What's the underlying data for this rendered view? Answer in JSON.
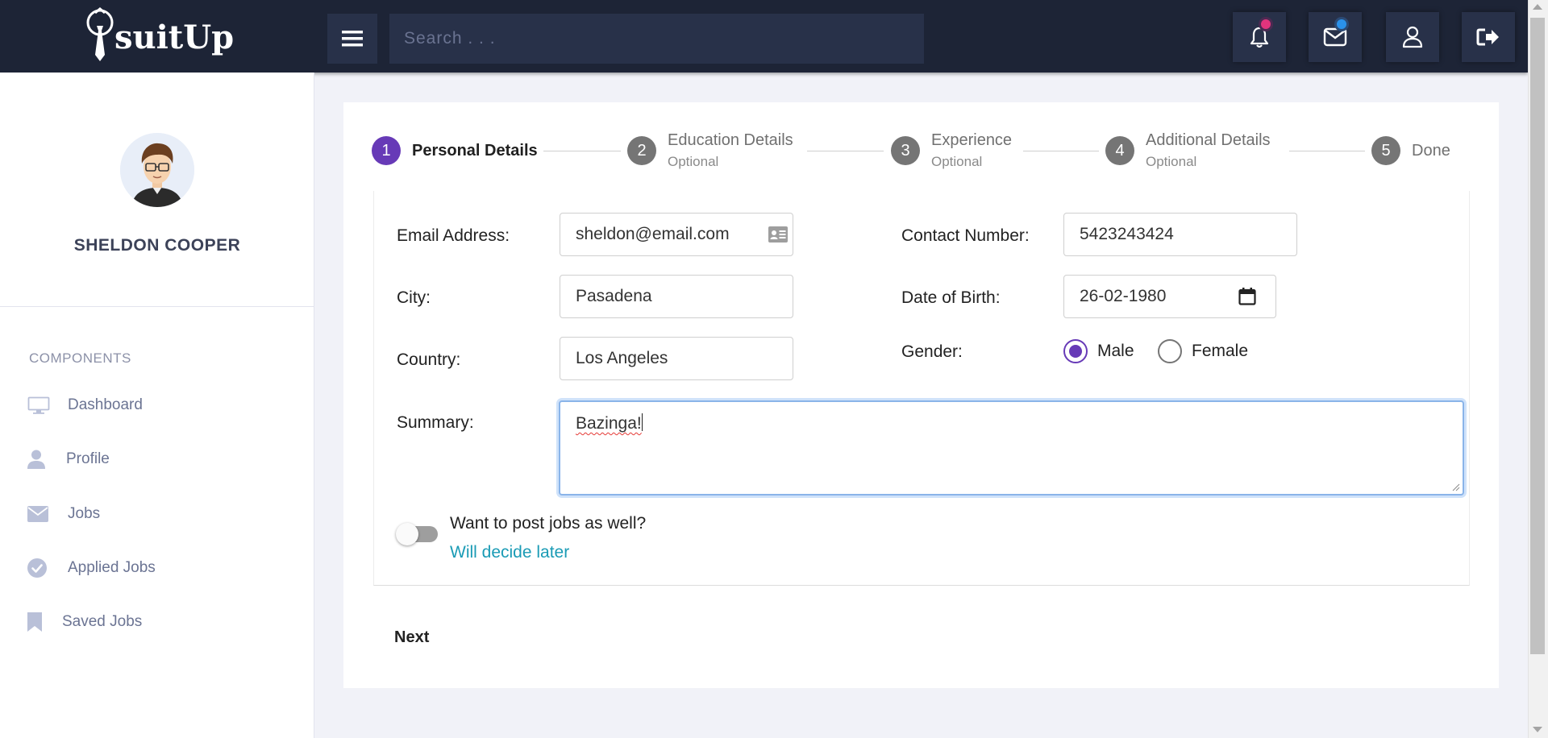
{
  "header": {
    "brand": "suitUp",
    "search_placeholder": "Search . . .",
    "icons": [
      "menu-icon",
      "bell-icon",
      "envelope-icon",
      "user-icon",
      "logout-icon"
    ],
    "colors": {
      "bar": "#1d2436",
      "button": "#283149",
      "notify_dot": "#e2347d",
      "mail_dot": "#2a91ea"
    }
  },
  "sidebar": {
    "user_name": "SHELDON COOPER",
    "section_label": "COMPONENTS",
    "items": [
      {
        "label": "Dashboard",
        "icon": "monitor-icon"
      },
      {
        "label": "Profile",
        "icon": "person-icon"
      },
      {
        "label": "Jobs",
        "icon": "envelope-icon"
      },
      {
        "label": "Applied Jobs",
        "icon": "check-circle-icon"
      },
      {
        "label": "Saved Jobs",
        "icon": "bookmark-icon"
      }
    ]
  },
  "stepper": {
    "steps": [
      {
        "num": "1",
        "label": "Personal Details",
        "sub": "",
        "active": true
      },
      {
        "num": "2",
        "label": "Education Details",
        "sub": "Optional",
        "active": false
      },
      {
        "num": "3",
        "label": "Experience",
        "sub": "Optional",
        "active": false
      },
      {
        "num": "4",
        "label": "Additional Details",
        "sub": "Optional",
        "active": false
      },
      {
        "num": "5",
        "label": "Done",
        "sub": "",
        "active": false
      }
    ],
    "active_color": "#673ab7"
  },
  "form": {
    "email": {
      "label": "Email Address:",
      "value": "sheldon@email.com"
    },
    "contact": {
      "label": "Contact Number:",
      "value": "5423243424"
    },
    "city": {
      "label": "City:",
      "value": "Pasadena"
    },
    "dob": {
      "label": "Date of Birth:",
      "value": "26-02-1980"
    },
    "country": {
      "label": "Country:",
      "value": "Los Angeles"
    },
    "gender": {
      "label": "Gender:",
      "options": [
        "Male",
        "Female"
      ],
      "selected": "Male"
    },
    "summary": {
      "label": "Summary:",
      "value": "Bazinga!"
    },
    "post_jobs": {
      "question": "Want to post jobs as well?",
      "state_text": "Will decide later",
      "on": false
    },
    "next_label": "Next"
  }
}
